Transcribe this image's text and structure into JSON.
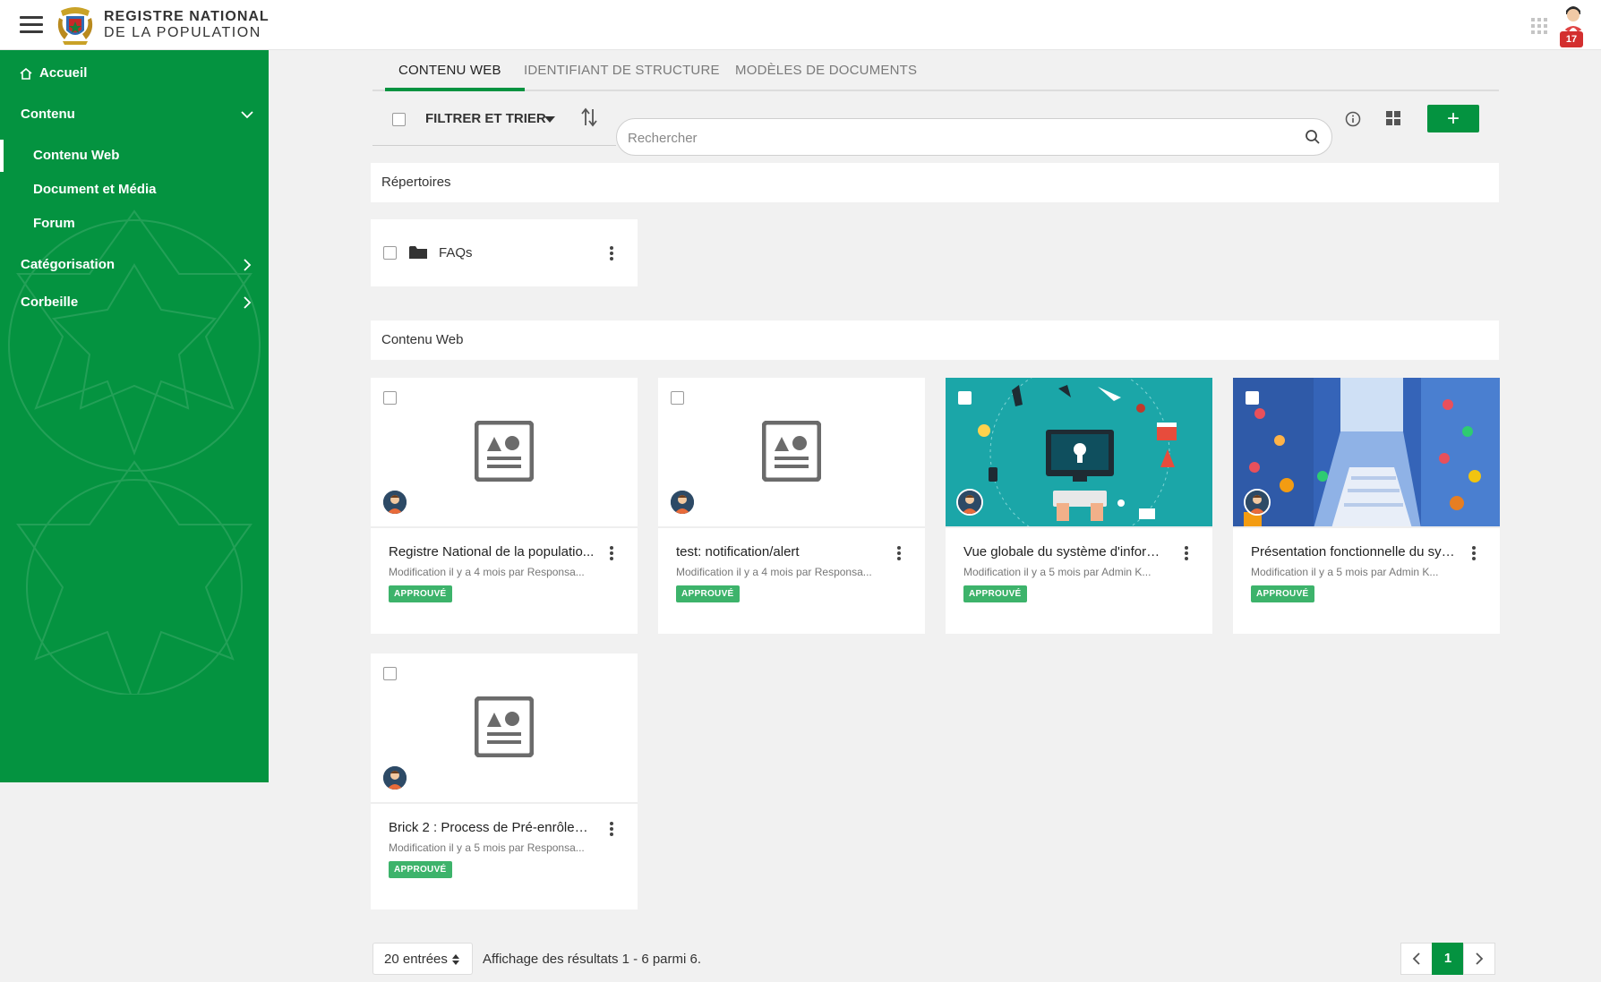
{
  "header": {
    "brand_line1": "REGISTRE NATIONAL",
    "brand_line2": "DE LA POPULATION",
    "notification_count": "17"
  },
  "sidebar": {
    "items": [
      {
        "label": "Accueil",
        "icon": "home-icon"
      },
      {
        "label": "Contenu",
        "icon": "chevron-down-icon"
      },
      {
        "label": "Contenu Web",
        "active": true
      },
      {
        "label": "Document et Média"
      },
      {
        "label": "Forum"
      },
      {
        "label": "Catégorisation",
        "icon": "chevron-right-icon"
      },
      {
        "label": "Corbeille",
        "icon": "chevron-right-icon"
      }
    ]
  },
  "tabs": [
    {
      "label": "CONTENU WEB",
      "active": true
    },
    {
      "label": "IDENTIFIANT DE STRUCTURE"
    },
    {
      "label": "MODÈLES DE DOCUMENTS"
    }
  ],
  "toolbar": {
    "filter_label": "FILTRER ET TRIER",
    "search_placeholder": "Rechercher",
    "add_label": "+"
  },
  "sections": {
    "folders_title": "Répertoires",
    "content_title": "Contenu Web"
  },
  "folders": [
    {
      "name": "FAQs"
    }
  ],
  "cards": [
    {
      "title": "Registre National de la populatio...",
      "meta": "Modification il y a 4 mois par Responsa...",
      "status": "APPROUVÉ",
      "thumb": "placeholder"
    },
    {
      "title": "test: notification/alert",
      "meta": "Modification il y a 4 mois par Responsa...",
      "status": "APPROUVÉ",
      "thumb": "placeholder"
    },
    {
      "title": "Vue globale du système d'informa...",
      "meta": "Modification il y a 5 mois par Admin K...",
      "status": "APPROUVÉ",
      "thumb": "tech-illustration"
    },
    {
      "title": "Présentation fonctionnelle du sys...",
      "meta": "Modification il y a 5 mois par Admin K...",
      "status": "APPROUVÉ",
      "thumb": "blue-street-photo"
    },
    {
      "title": "Brick 2 : Process de Pré-enrôleme...",
      "meta": "Modification il y a 5 mois par Responsa...",
      "status": "APPROUVÉ",
      "thumb": "placeholder"
    }
  ],
  "footer": {
    "entries_label": "20 entrées",
    "results_text": "Affichage des résultats 1 - 6 parmi 6.",
    "current_page": "1"
  },
  "colors": {
    "brand_green": "#049340",
    "badge_green": "#3db36b",
    "notification_red": "#d32f2f"
  }
}
